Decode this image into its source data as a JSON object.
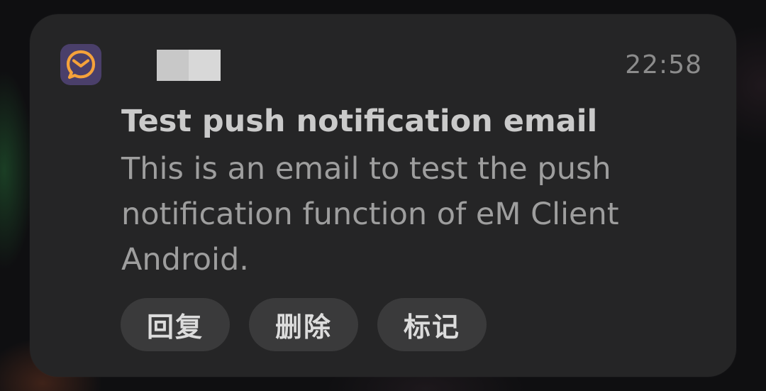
{
  "notification": {
    "app_icon": "em-client-mail-icon",
    "time": "22:58",
    "title": "Test push notification email",
    "body": "This is an email to test the push notification function of eM Client Android.",
    "actions": [
      {
        "label": "回复"
      },
      {
        "label": "删除"
      },
      {
        "label": "标记"
      }
    ]
  },
  "colors": {
    "card": "#252526",
    "icon_bg": "#4a3f6a",
    "icon_accent": "#f5a23a",
    "button_bg": "#3a3a3b"
  }
}
